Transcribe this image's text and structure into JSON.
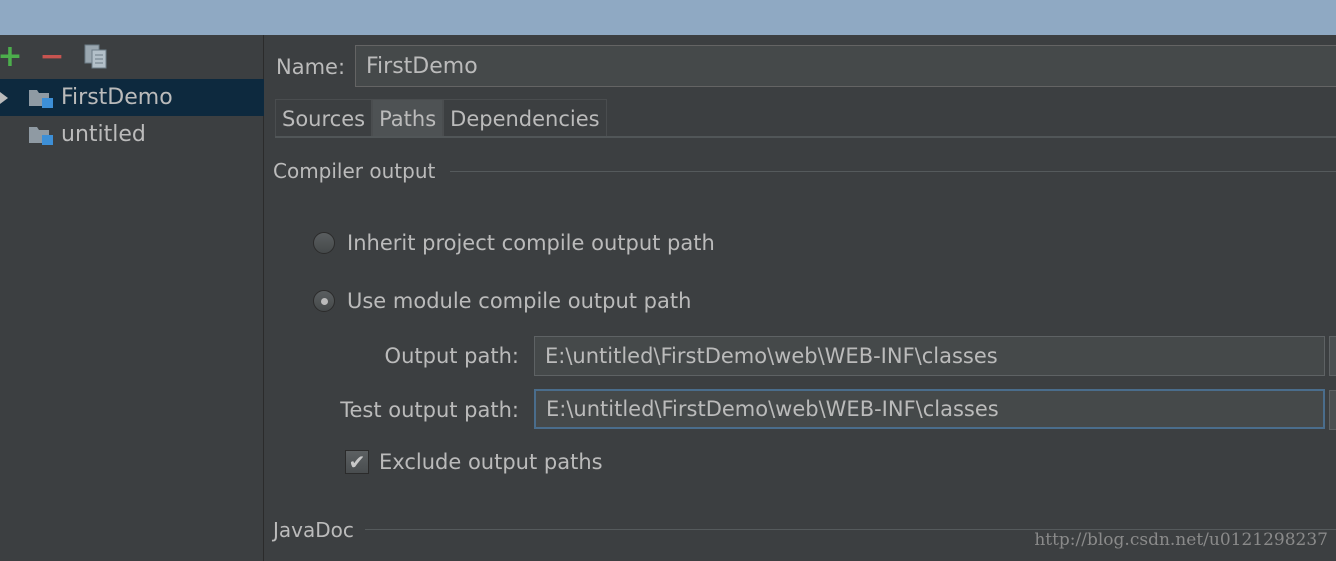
{
  "sidebar": {
    "toolbar": {
      "add_icon": "plus-icon",
      "remove_icon": "minus-icon",
      "copy_icon": "copy-icon"
    },
    "items": [
      {
        "label": "FirstDemo",
        "selected": true,
        "icon": "module-folder-icon"
      },
      {
        "label": "untitled",
        "selected": false,
        "icon": "module-folder-icon"
      }
    ]
  },
  "main": {
    "name_label": "Name:",
    "name_value": "FirstDemo",
    "tabs": [
      {
        "label": "Sources",
        "active": false
      },
      {
        "label": "Paths",
        "active": true
      },
      {
        "label": "Dependencies",
        "active": false
      }
    ],
    "compiler_output": {
      "title": "Compiler output",
      "inherit_label": "Inherit project compile output path",
      "use_module_label": "Use module compile output path",
      "output_path_label": "Output path:",
      "output_path_value": "E:\\untitled\\FirstDemo\\web\\WEB-INF\\classes",
      "test_output_path_label": "Test output path:",
      "test_output_path_value": "E:\\untitled\\FirstDemo\\web\\WEB-INF\\classes",
      "exclude_label": "Exclude output paths",
      "exclude_checked": true
    },
    "javadoc_title": "JavaDoc"
  },
  "watermark": "http://blog.csdn.net/u0121298237",
  "colors": {
    "background": "#3c3f41",
    "titlebar": "#8fa9c3",
    "selection": "#0d293e",
    "text": "#bbbbbb",
    "add": "#4cae4c",
    "remove": "#c75450",
    "focus": "#4a6d8c"
  }
}
